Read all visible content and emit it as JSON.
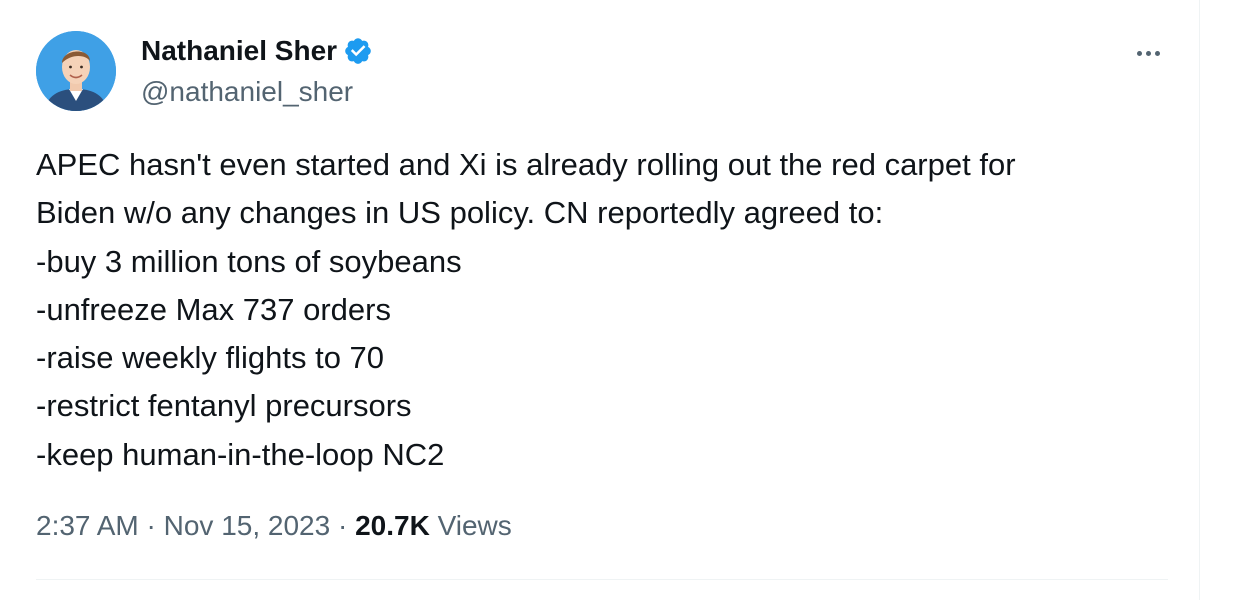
{
  "tweet": {
    "author": {
      "name": "Nathaniel Sher",
      "handle": "@nathaniel_sher",
      "verified": true,
      "verified_icon": "verified-badge-icon",
      "verified_color": "#1d9bf0"
    },
    "text": "APEC hasn't even started and Xi is already rolling out the red carpet for\nBiden w/o any changes in US policy. CN reportedly agreed to:\n-buy 3 million tons of soybeans\n-unfreeze Max 737 orders\n-raise weekly flights to 70\n-restrict fentanyl precursors\n-keep human-in-the-loop NC2",
    "time": "2:37 AM",
    "separator": "·",
    "date": "Nov 15, 2023",
    "views_count": "20.7K",
    "views_label": "Views",
    "more_icon": "more-options-icon"
  },
  "colors": {
    "text_primary": "#0f1419",
    "text_secondary": "#536471",
    "accent": "#1d9bf0",
    "divider": "#eff3f4"
  }
}
